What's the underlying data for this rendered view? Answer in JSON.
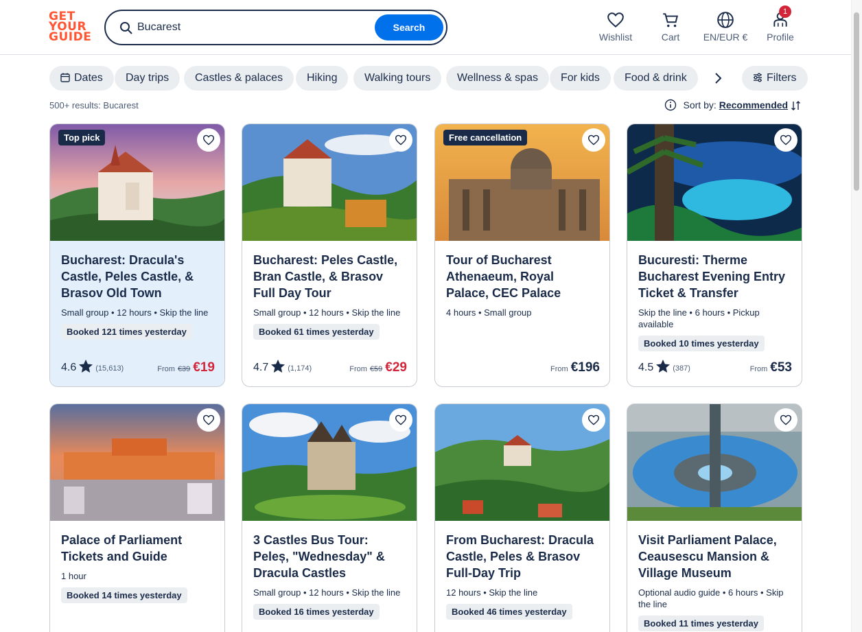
{
  "header": {
    "logo_lines": [
      "GET",
      "YOUR",
      "GUIDE"
    ],
    "search": {
      "value": "Bucarest",
      "button": "Search"
    },
    "nav": [
      {
        "label": "Wishlist",
        "icon": "heart-icon"
      },
      {
        "label": "Cart",
        "icon": "cart-icon"
      },
      {
        "label": "EN/EUR €",
        "icon": "globe-icon"
      },
      {
        "label": "Profile",
        "icon": "profile-icon",
        "badge": "1"
      }
    ]
  },
  "filters": {
    "chips": [
      "Dates",
      "Day trips",
      "Castles & palaces",
      "Hiking",
      "Walking tours",
      "Wellness & spas",
      "For kids",
      "Food & drink"
    ],
    "filters_label": "Filters"
  },
  "results": {
    "count_text": "500+ results: Bucarest",
    "sort_label": "Sort by:",
    "sort_value": "Recommended"
  },
  "colors": {
    "brand": "#ff5533",
    "accent": "#0071eb",
    "sale": "#d3253a",
    "ink": "#1a2b49"
  },
  "cards": [
    {
      "tag": "Top pick",
      "title": "Bucharest: Dracula's Castle, Peles Castle, & Brasov Old Town",
      "meta": "Small group • 12 hours • Skip the line",
      "booked": "Booked 121 times yesterday",
      "rating": "4.6",
      "reviews": "(15,613)",
      "from": "From",
      "old_price": "€39",
      "price": "€19"
    },
    {
      "tag": "",
      "title": "Bucharest: Peles Castle, Bran Castle, & Brasov Full Day Tour",
      "meta": "Small group • 12 hours • Skip the line",
      "booked": "Booked 61 times yesterday",
      "rating": "4.7",
      "reviews": "(1,174)",
      "from": "From",
      "old_price": "€59",
      "price": "€29"
    },
    {
      "tag": "Free cancellation",
      "title": "Tour of Bucharest Athenaeum, Royal Palace, CEC Palace",
      "meta": "4 hours • Small group",
      "booked": "",
      "rating": "",
      "reviews": "",
      "from": "From",
      "old_price": "",
      "price": "€196"
    },
    {
      "tag": "",
      "title": "Bucuresti: Therme Bucharest Evening Entry Ticket & Transfer",
      "meta": "Skip the line • 6 hours • Pickup available",
      "booked": "Booked 10 times yesterday",
      "rating": "4.5",
      "reviews": "(387)",
      "from": "From",
      "old_price": "",
      "price": "€53"
    },
    {
      "tag": "",
      "title": "Palace of Parliament Tickets and Guide",
      "meta": "1 hour",
      "booked": "Booked 14 times yesterday"
    },
    {
      "tag": "",
      "title": "3 Castles Bus Tour: Peleș, \"Wednesday\" & Dracula Castles",
      "meta": "Small group • 12 hours • Skip the line",
      "booked": "Booked 16 times yesterday"
    },
    {
      "tag": "",
      "title": "From Bucharest: Dracula Castle, Peles & Brasov Full-Day Trip",
      "meta": "12 hours • Skip the line",
      "booked": "Booked 46 times yesterday"
    },
    {
      "tag": "",
      "title": "Visit Parliament Palace, Ceausescu Mansion & Village Museum",
      "meta": "Optional audio guide • 6 hours • Skip the line",
      "booked": "Booked 11 times yesterday"
    }
  ]
}
